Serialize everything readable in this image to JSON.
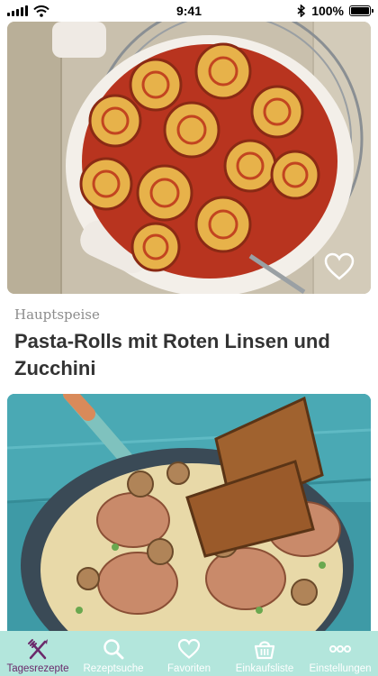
{
  "status_bar": {
    "time": "9:41",
    "battery_percent": "100%",
    "icons": [
      "signal-icon",
      "wifi-icon",
      "bluetooth-icon",
      "battery-icon"
    ]
  },
  "feed": {
    "cards": [
      {
        "category": "Hauptspeise",
        "title": "Pasta-Rolls mit Roten Linsen und Zucchini",
        "image": "pasta-rolls-casserole-photo",
        "favorite_icon": "heart-outline-icon"
      },
      {
        "category": "",
        "title": "",
        "image": "pork-medallions-mushroom-cream-photo",
        "favorite_icon": "heart-outline-icon"
      }
    ]
  },
  "tab_bar": {
    "active_color": "#6b2a6b",
    "background": "#b3e6dc",
    "tabs": [
      {
        "label": "Tagesrezepte",
        "icon": "fork-knife-icon",
        "active": true
      },
      {
        "label": "Rezeptsuche",
        "icon": "search-icon",
        "active": false
      },
      {
        "label": "Favoriten",
        "icon": "heart-icon",
        "active": false
      },
      {
        "label": "Einkaufsliste",
        "icon": "basket-icon",
        "active": false
      },
      {
        "label": "Einstellungen",
        "icon": "more-dots-icon",
        "active": false
      }
    ]
  }
}
